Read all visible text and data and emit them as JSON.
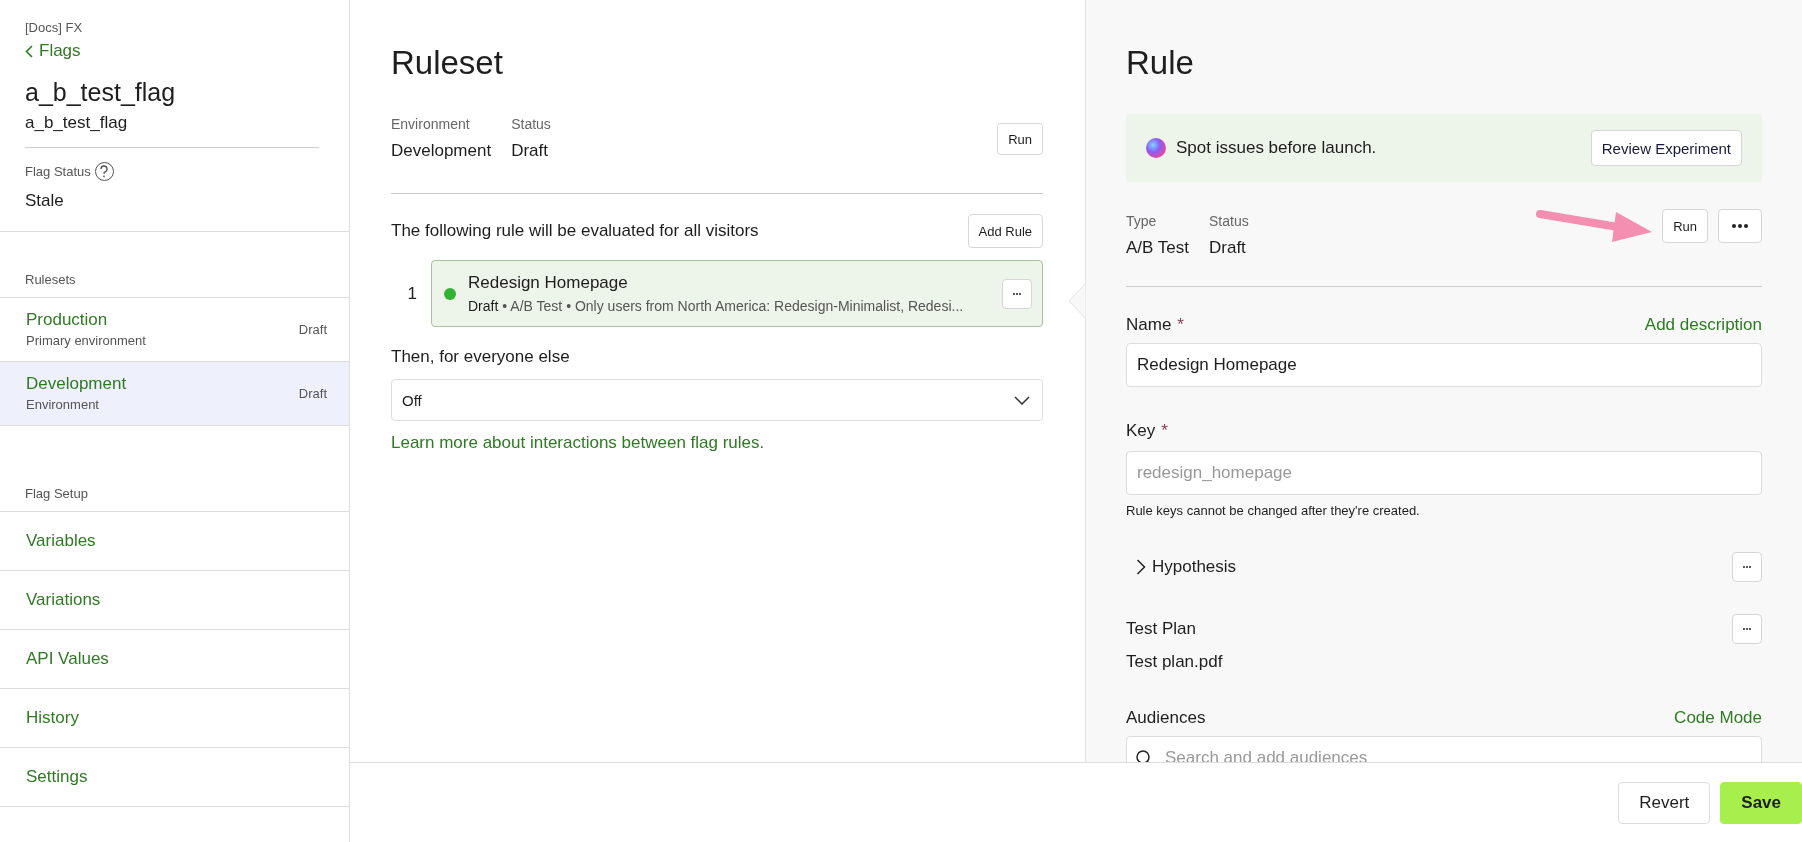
{
  "sidebar": {
    "project": "[Docs] FX",
    "back_link": "Flags",
    "flag_name": "a_b_test_flag",
    "flag_key": "a_b_test_flag",
    "flag_status": {
      "label": "Flag Status",
      "value": "Stale"
    },
    "rulesets": {
      "heading": "Rulesets",
      "items": [
        {
          "name": "Production",
          "description": "Primary environment",
          "status": "Draft",
          "selected": false
        },
        {
          "name": "Development",
          "description": "Environment",
          "status": "Draft",
          "selected": true
        }
      ]
    },
    "setup": {
      "heading": "Flag Setup",
      "items": [
        {
          "label": "Variables",
          "selected": false
        },
        {
          "label": "Variations",
          "selected": false
        },
        {
          "label": "API Values",
          "selected": false
        },
        {
          "label": "History",
          "selected": false
        },
        {
          "label": "Settings",
          "selected": false
        }
      ]
    }
  },
  "ruleset": {
    "title": "Ruleset",
    "meta": [
      {
        "label": "Environment",
        "value": "Development"
      },
      {
        "label": "Status",
        "value": "Draft"
      }
    ],
    "run_button": "Run",
    "rules_intro": "The following rule will be evaluated for all visitors",
    "add_rule_button": "Add Rule",
    "rules": [
      {
        "number": "1",
        "name": "Redesign Homepage",
        "status": "Draft",
        "summary": "• A/B Test • Only users from North America: Redesign-Minimalist, Redesi...",
        "active": true,
        "selected": true
      }
    ],
    "fallback_label": "Then, for everyone else",
    "fallback_value": "Off",
    "learn_link": "Learn more about interactions between flag rules."
  },
  "rule": {
    "title": "Rule",
    "banner": {
      "text": "Spot issues before launch.",
      "button": "Review Experiment"
    },
    "meta": [
      {
        "label": "Type",
        "value": "A/B Test"
      },
      {
        "label": "Status",
        "value": "Draft"
      }
    ],
    "run_button": "Run",
    "name_field": {
      "label": "Name",
      "required_mark": "*",
      "link": "Add description",
      "value": "Redesign Homepage"
    },
    "key_field": {
      "label": "Key",
      "required_mark": "*",
      "placeholder": "redesign_homepage",
      "help": "Rule keys cannot be changed after they're created."
    },
    "hypothesis": {
      "label": "Hypothesis",
      "expanded": false
    },
    "test_plan": {
      "label": "Test Plan",
      "file": "Test plan.pdf"
    },
    "audiences": {
      "label": "Audiences",
      "link": "Code Mode",
      "placeholder": "Search and add audiences"
    }
  },
  "footer": {
    "buttons": [
      {
        "label": "Revert",
        "kind": "secondary"
      },
      {
        "label": "Save",
        "kind": "primary"
      }
    ]
  }
}
